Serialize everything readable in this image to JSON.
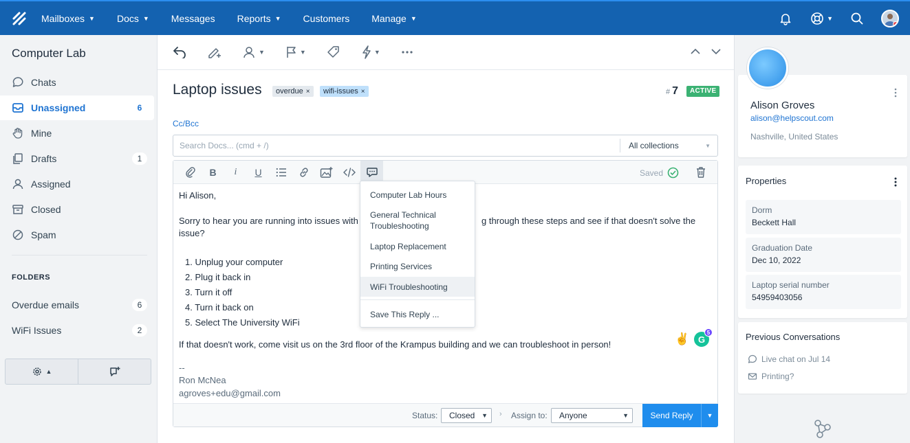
{
  "nav": {
    "items": [
      {
        "label": "Mailboxes",
        "chevron": true
      },
      {
        "label": "Docs",
        "chevron": true
      },
      {
        "label": "Messages",
        "chevron": false
      },
      {
        "label": "Reports",
        "chevron": true
      },
      {
        "label": "Customers",
        "chevron": false
      },
      {
        "label": "Manage",
        "chevron": true
      }
    ]
  },
  "sidebar": {
    "title": "Computer Lab",
    "items": [
      {
        "label": "Chats",
        "count": "",
        "icon": "chat-icon"
      },
      {
        "label": "Unassigned",
        "count": "6",
        "icon": "inbox-icon"
      },
      {
        "label": "Mine",
        "count": "",
        "icon": "hand-icon"
      },
      {
        "label": "Drafts",
        "count": "1",
        "icon": "drafts-icon"
      },
      {
        "label": "Assigned",
        "count": "",
        "icon": "person-icon"
      },
      {
        "label": "Closed",
        "count": "",
        "icon": "archive-icon"
      },
      {
        "label": "Spam",
        "count": "",
        "icon": "ban-icon"
      }
    ],
    "folders_label": "FOLDERS",
    "folders": [
      {
        "label": "Overdue emails",
        "count": "6"
      },
      {
        "label": "WiFi Issues",
        "count": "2"
      }
    ]
  },
  "conversation": {
    "subject": "Laptop issues",
    "tags": [
      "overdue",
      "wifi-issues"
    ],
    "tag_close": "×",
    "hash": "#",
    "number": "7",
    "status": "ACTIVE",
    "ccbcc": "Cc/Bcc",
    "docs_search_placeholder": "Search Docs... (cmd + /)",
    "collections": "All collections",
    "saved_label": "Saved",
    "body": {
      "greeting": "Hi Alison,",
      "line1a": "Sorry to hear you are running into issues with",
      "line1b": "g through these steps and see if that doesn't solve the",
      "line1c": "issue?",
      "steps": [
        "1. Unplug your computer",
        "2. Plug it back in",
        "3. Turn it off",
        "4. Turn it back on",
        "5. Select The University WiFi"
      ],
      "closing": "If that doesn't work, come visit us on the 3rd floor of the Krampus building and we can troubleshoot in person!",
      "sig_dash": "--",
      "sig_name": "Ron McNea",
      "sig_email": "agroves+edu@gmail.com"
    },
    "emoji": "✌️",
    "grammarly_letter": "G",
    "grammarly_count": "5",
    "footer": {
      "status_label": "Status:",
      "status_value": "Closed",
      "assign_label": "Assign to:",
      "assign_value": "Anyone",
      "send_label": "Send Reply"
    }
  },
  "saved_replies": {
    "items": [
      "Computer Lab Hours",
      "General Technical Troubleshooting",
      "Laptop Replacement",
      "Printing Services",
      "WiFi Troubleshooting"
    ],
    "highlighted": 4,
    "save_label": "Save This Reply ..."
  },
  "customer": {
    "name": "Alison Groves",
    "email": "alison@helpscout.com",
    "location": "Nashville, United States"
  },
  "properties": {
    "title": "Properties",
    "items": [
      {
        "key": "Dorm",
        "value": "Beckett Hall"
      },
      {
        "key": "Graduation Date",
        "value": "Dec 10, 2022"
      },
      {
        "key": "Laptop serial number",
        "value": "54959403056"
      }
    ]
  },
  "previous": {
    "title": "Previous Conversations",
    "items": [
      {
        "label": "Live chat on Jul 14",
        "icon": "chat-icon"
      },
      {
        "label": "Printing?",
        "icon": "email-icon"
      }
    ]
  },
  "colors": {
    "nav_bg": "#1462b0",
    "accent": "#1f74d2",
    "send": "#1f8ded",
    "active": "#3bb273"
  }
}
